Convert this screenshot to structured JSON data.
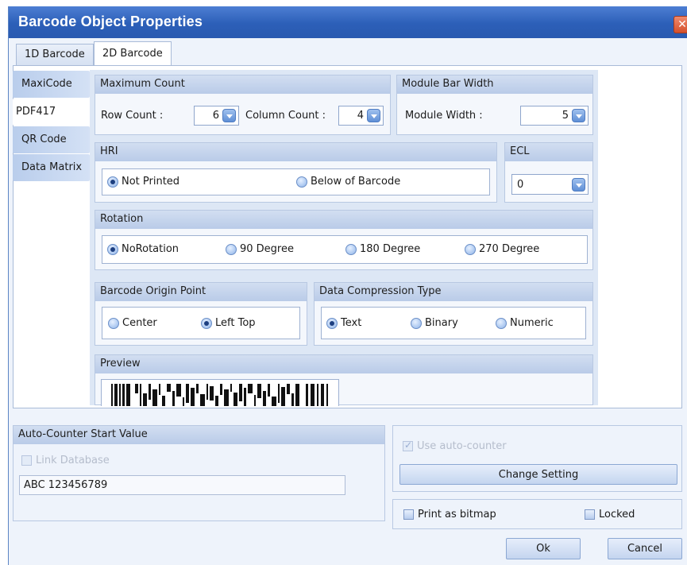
{
  "window": {
    "title": "Barcode Object Properties",
    "close_glyph": "✕"
  },
  "tabs": [
    {
      "label": "1D Barcode"
    },
    {
      "label": "2D Barcode"
    }
  ],
  "symbology": [
    {
      "label": "MaxiCode"
    },
    {
      "label": "PDF417"
    },
    {
      "label": "QR Code"
    },
    {
      "label": "Data Matrix"
    }
  ],
  "max_count": {
    "title": "Maximum Count",
    "row_label": "Row Count :",
    "row_value": "6",
    "col_label": "Column Count :",
    "col_value": "4"
  },
  "module_bar": {
    "title": "Module Bar Width",
    "width_label": "Module Width :",
    "width_value": "5"
  },
  "hri": {
    "title": "HRI",
    "options": [
      "Not Printed",
      "Below of Barcode"
    ],
    "selected": "Not Printed"
  },
  "ecl": {
    "title": "ECL",
    "value": "0"
  },
  "rotation": {
    "title": "Rotation",
    "options": [
      "NoRotation",
      "90 Degree",
      "180 Degree",
      "270 Degree"
    ],
    "selected": "NoRotation"
  },
  "origin": {
    "title": "Barcode Origin Point",
    "options": [
      "Center",
      "Left Top"
    ],
    "selected": "Left Top"
  },
  "compression": {
    "title": "Data Compression Type",
    "options": [
      "Text",
      "Binary",
      "Numeric"
    ],
    "selected": "Text"
  },
  "preview": {
    "title": "Preview"
  },
  "auto_counter": {
    "title": "Auto-Counter Start Value",
    "link_database_label": "Link Database",
    "value": "ABC 123456789",
    "use_auto_counter_label": "Use auto-counter",
    "change_setting_label": "Change Setting"
  },
  "options": {
    "print_bitmap_label": "Print as bitmap",
    "locked_label": "Locked"
  },
  "footer": {
    "ok_label": "Ok",
    "cancel_label": "Cancel"
  },
  "colors": {
    "titlebar": "#2c5fb8",
    "panel": "#eef3fb",
    "accent": "#5f8fd6"
  },
  "icons": [
    "close-icon",
    "spin-down-icon",
    "dropdown-icon"
  ]
}
